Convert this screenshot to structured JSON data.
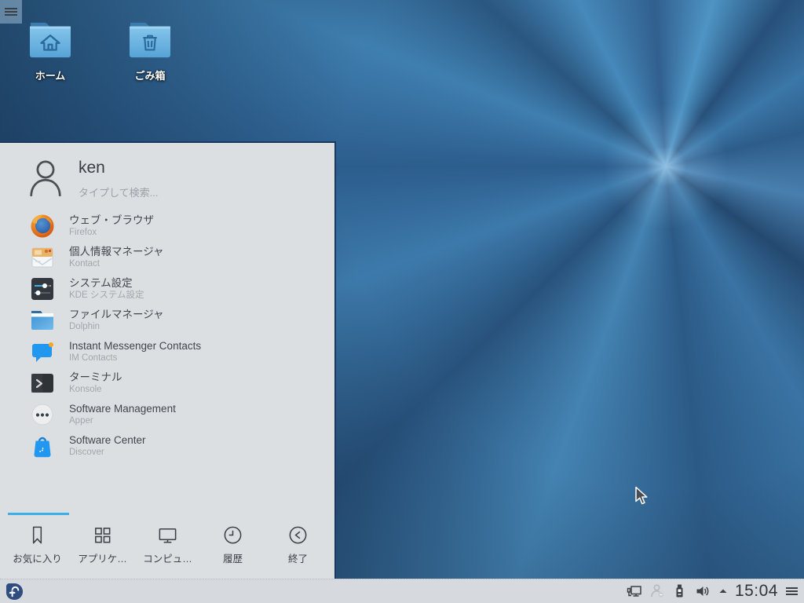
{
  "desktop": {
    "toolbox_icon": "hamburger-icon",
    "icons": [
      {
        "label": "ホーム",
        "icon": "home-folder-icon"
      },
      {
        "label": "ごみ箱",
        "icon": "trash-folder-icon"
      }
    ]
  },
  "launcher": {
    "user": {
      "name": "ken",
      "avatar_icon": "user-avatar-icon",
      "search_placeholder": "タイプして検索..."
    },
    "items": [
      {
        "title": "ウェブ・ブラウザ",
        "subtitle": "Firefox",
        "icon": "firefox-icon"
      },
      {
        "title": "個人情報マネージャ",
        "subtitle": "Kontact",
        "icon": "kontact-icon"
      },
      {
        "title": "システム設定",
        "subtitle": "KDE システム設定",
        "icon": "system-settings-icon"
      },
      {
        "title": "ファイルマネージャ",
        "subtitle": "Dolphin",
        "icon": "dolphin-icon"
      },
      {
        "title": "Instant Messenger Contacts",
        "subtitle": "IM Contacts",
        "icon": "im-contacts-icon"
      },
      {
        "title": "ターミナル",
        "subtitle": "Konsole",
        "icon": "konsole-icon"
      },
      {
        "title": "Software Management",
        "subtitle": "Apper",
        "icon": "apper-icon"
      },
      {
        "title": "Software Center",
        "subtitle": "Discover",
        "icon": "discover-icon"
      }
    ],
    "tabs": [
      {
        "label": "お気に入り",
        "icon": "bookmark-icon",
        "active": true
      },
      {
        "label": "アプリケ…",
        "icon": "applications-grid-icon",
        "active": false
      },
      {
        "label": "コンピュ…",
        "icon": "computer-monitor-icon",
        "active": false
      },
      {
        "label": "履歴",
        "icon": "history-clock-icon",
        "active": false
      },
      {
        "label": "終了",
        "icon": "leave-icon",
        "active": false
      }
    ]
  },
  "taskbar": {
    "launcher_icon": "fedora-logo-icon",
    "tray_icons": [
      "network-icon",
      "im-status-offline-icon",
      "device-notifier-icon",
      "volume-icon"
    ],
    "expander_icon": "caret-up-icon",
    "clock": "15:04",
    "overflow_icon": "hamburger-icon"
  },
  "colors": {
    "accent": "#3daee9",
    "panel_bg": "#dcdfe2",
    "taskbar_bg": "#d6dade",
    "panel_border": "#18395d",
    "wallpaper_base": "#2c5d8d"
  }
}
